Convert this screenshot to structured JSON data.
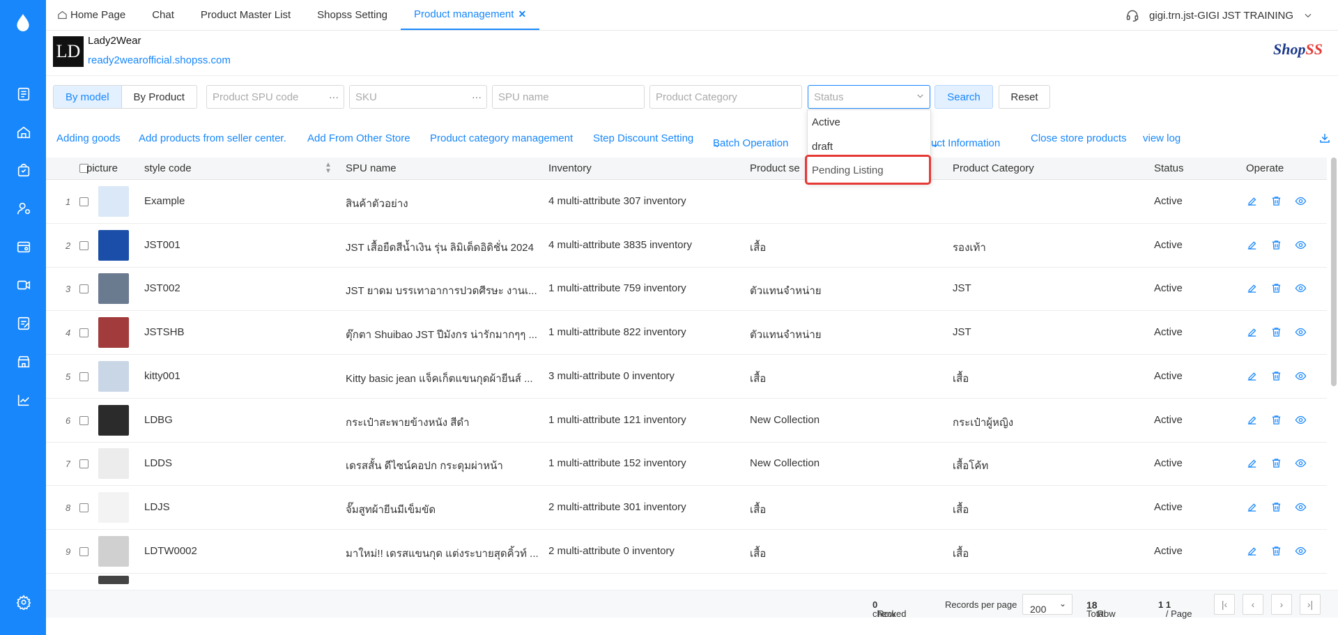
{
  "nav": {
    "tabs": [
      "Home Page",
      "Chat",
      "Product Master List",
      "Shopss Setting",
      "Product management"
    ],
    "user": "gigi.trn.jst-GIGI JST TRAINING"
  },
  "store": {
    "logo": "LD",
    "name": "Lady2Wear",
    "url": "ready2wearofficial.shopss.com",
    "brand_a": "Shop",
    "brand_b": "SS"
  },
  "filters": {
    "by_model": "By model",
    "by_product": "By Product",
    "spu_code": "Product SPU code",
    "sku": "SKU",
    "spu_name": "SPU name",
    "category": "Product Category",
    "status": "Status",
    "search": "Search",
    "reset": "Reset",
    "dots": "···"
  },
  "status_options": [
    "Active",
    "draft",
    "Pending Listing"
  ],
  "toolbar": {
    "adding_goods": "Adding goods",
    "add_seller": "Add products from seller center.",
    "add_other": "Add From Other Store",
    "category_mgmt": "Product category management",
    "step_discount": "Step Discount Setting",
    "batch": "Batch Operation",
    "product_info": "uct Information",
    "close_store": "Close store products",
    "view_log": "view log"
  },
  "table": {
    "headers": [
      "picture",
      "style code",
      "SPU name",
      "Inventory",
      "Product se",
      "Product Category",
      "Status",
      "Operate"
    ],
    "rows": [
      {
        "n": "1",
        "code": "Example",
        "name": "สินค้าตัวอย่าง",
        "inv": "4 multi-attribute 307 inventory",
        "series": "",
        "cat": "",
        "status": "Active"
      },
      {
        "n": "2",
        "code": "JST001",
        "name": "JST เสื้อยืดสีน้ำเงิน รุ่น ลิมิเต็ดอิดิชั่น 2024",
        "inv": "4 multi-attribute 3835 inventory",
        "series": "เสื้อ",
        "cat": "รองเท้า",
        "status": "Active"
      },
      {
        "n": "3",
        "code": "JST002",
        "name": "JST ยาดม บรรเทาอาการปวดศีรษะ งานเ...",
        "inv": "1 multi-attribute 759 inventory",
        "series": "ตัวแทนจำหน่าย",
        "cat": "JST",
        "status": "Active"
      },
      {
        "n": "4",
        "code": "JSTSHB",
        "name": "ตุ๊กตา Shuibao JST ปีมังกร น่ารักมากๆๆ ...",
        "inv": "1 multi-attribute 822 inventory",
        "series": "ตัวแทนจำหน่าย",
        "cat": "JST",
        "status": "Active"
      },
      {
        "n": "5",
        "code": "kitty001",
        "name": "Kitty basic jean แจ็คเก็ตแขนกุดผ้ายีนส์ ...",
        "inv": "3 multi-attribute 0 inventory",
        "series": "เสื้อ",
        "cat": "เสื้อ",
        "status": "Active"
      },
      {
        "n": "6",
        "code": "LDBG",
        "name": "กระเป๋าสะพายข้างหนัง สีดำ",
        "inv": "1 multi-attribute 121 inventory",
        "series": "New Collection",
        "cat": "กระเป๋าผู้หญิง",
        "status": "Active"
      },
      {
        "n": "7",
        "code": "LDDS",
        "name": "เดรสสั้น ดีไซน์คอปก กระดุมผ่าหน้า",
        "inv": "1 multi-attribute 152 inventory",
        "series": "New Collection",
        "cat": "เสื้อโค้ท",
        "status": "Active"
      },
      {
        "n": "8",
        "code": "LDJS",
        "name": "จั๊มสูทผ้ายีนมีเข็มขัด",
        "inv": "2 multi-attribute 301 inventory",
        "series": "เสื้อ",
        "cat": "เสื้อ",
        "status": "Active"
      },
      {
        "n": "9",
        "code": "LDTW0002",
        "name": "มาใหม่!! เดรสแขนกุด แต่งระบายสุดคิ้วท์ ...",
        "inv": "2 multi-attribute 0 inventory",
        "series": "เสื้อ",
        "cat": "เสื้อ",
        "status": "Active"
      }
    ]
  },
  "footer": {
    "checked_label": "checked",
    "checked_count": "0",
    "row_label": "Row",
    "per_page_label": "Records per page",
    "per_page": "200",
    "total_label": "Total",
    "total": "18",
    "total_unit": "Row",
    "current_page": "1",
    "slash": "/",
    "total_pages": "1",
    "page_label": "Page"
  },
  "colors": {
    "accent": "#1787fb",
    "sidebar": "#1787fb",
    "highlight": "#e53935"
  }
}
